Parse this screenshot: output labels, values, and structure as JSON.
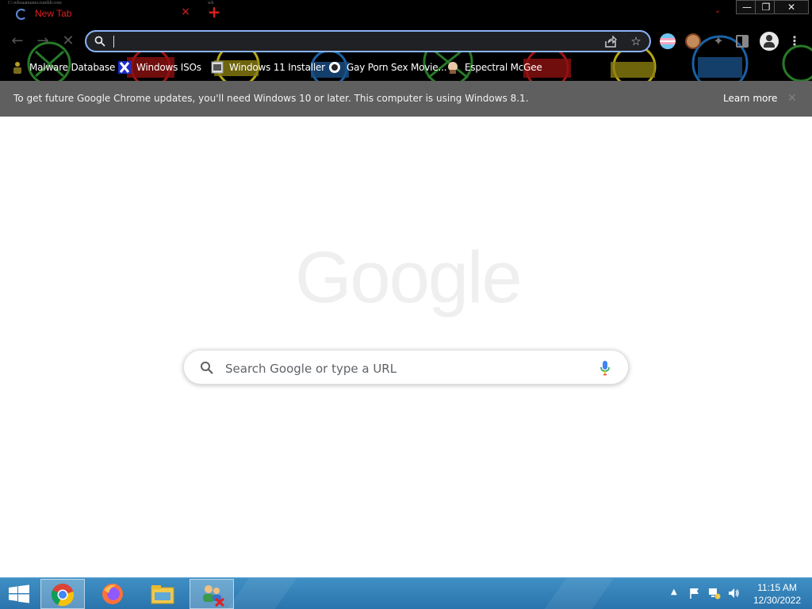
{
  "browser": {
    "tab": {
      "title": "New Tab",
      "close_glyph": "×",
      "meta_text": "C:\\whoaamunes.tumblr.com"
    },
    "new_tab_glyph": "+",
    "tab_search_glyph": "⌄",
    "tab_meta2": "wh",
    "window": {
      "minimize": "—",
      "maximize": "❐",
      "close": "✕"
    },
    "nav": {
      "back": "←",
      "forward": "→",
      "stop": "✕"
    },
    "omnibox": {
      "value": "",
      "star_glyph": "☆"
    },
    "menu_glyph": "⋮",
    "puzzle_glyph": "✦"
  },
  "bookmarks": [
    {
      "label": "Malware Database",
      "icon": "person-icon"
    },
    {
      "label": "Windows ISOs",
      "icon": "x-logo-icon"
    },
    {
      "label": "Windows 11 Installer",
      "icon": "window-icon"
    },
    {
      "label": "Gay Porn Sex Movie...",
      "icon": "site-icon"
    },
    {
      "label": "Espectral McGee",
      "icon": "character-icon"
    }
  ],
  "infobar": {
    "message": "To get future Google Chrome updates, you'll need Windows 10 or later. This computer is using Windows 8.1.",
    "learn_more": "Learn more",
    "close_glyph": "✕"
  },
  "ntp": {
    "logo_text": "Google",
    "search_placeholder": "Search Google or type a URL"
  },
  "taskbar": {
    "items": [
      "chrome",
      "firefox",
      "file-explorer",
      "user-accounts"
    ],
    "tray_arrow": "▲",
    "time": "11:15 AM",
    "date": "12/30/2022"
  },
  "colors": {
    "chrome_bg": "#000000",
    "tab_accent": "#e02020",
    "omnibox_border": "#8ab4f8",
    "infobar_bg": "#5f5f5f",
    "taskbar": "#3a86bf"
  }
}
